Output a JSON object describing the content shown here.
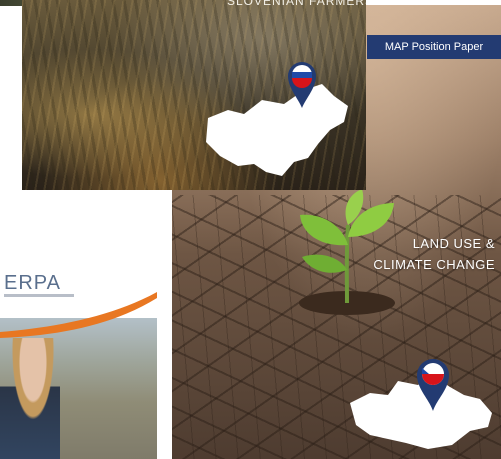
{
  "cards": {
    "slovenia": {
      "title": "SLOVENIAN FARMERS"
    },
    "czech": {
      "banner": "MAP Position Paper",
      "title_line1": "LAND USE &",
      "title_line2": "CLIMATE CHANGE"
    },
    "erpa": {
      "logo": "ERPA"
    }
  },
  "colors": {
    "banner_blue": "#233b72",
    "orange_swoosh": "#e87722",
    "flag_white": "#ffffff",
    "flag_blue": "#1f4aa8",
    "flag_red": "#d7141a"
  },
  "icons": [
    "map-pin-slovenia-icon",
    "map-pin-czech-icon",
    "slovenia-map-icon",
    "czech-map-icon",
    "seedling-image"
  ]
}
